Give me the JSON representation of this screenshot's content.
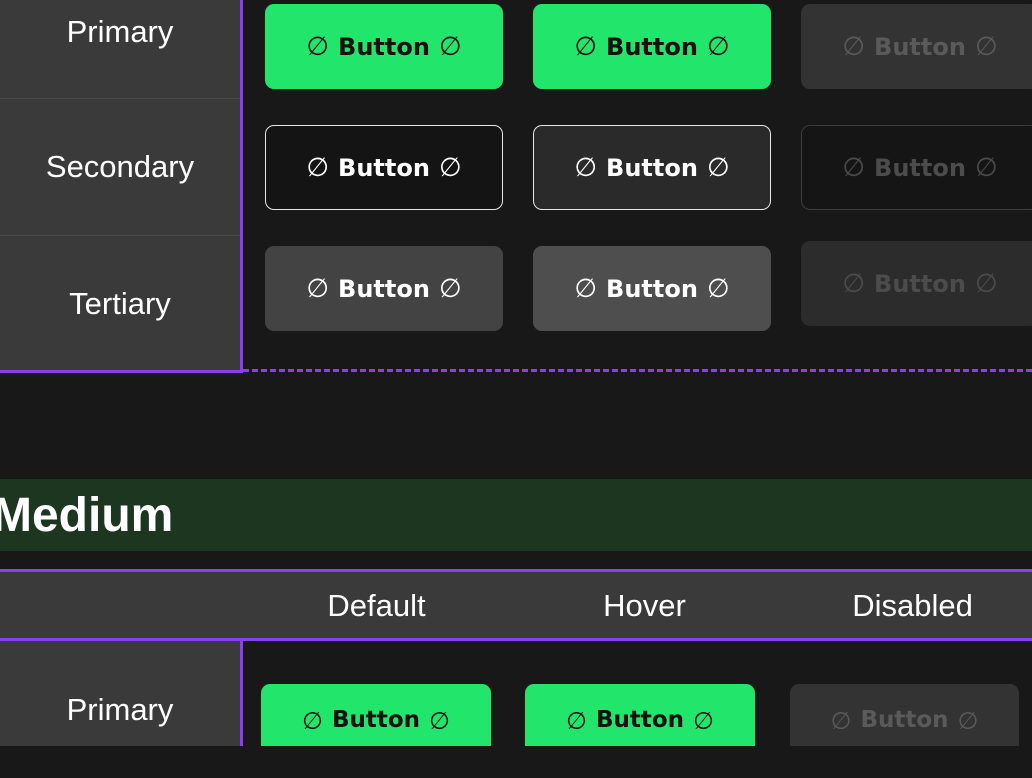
{
  "top_section": {
    "rows": [
      {
        "label": "Primary"
      },
      {
        "label": "Secondary"
      },
      {
        "label": "Tertiary"
      }
    ],
    "button_label": "Button",
    "leading_icon": "∅",
    "trailing_icon": "∅"
  },
  "medium_section": {
    "title": "Medium",
    "columns": [
      "Default",
      "Hover",
      "Disabled"
    ],
    "rows": [
      {
        "label": "Primary"
      }
    ],
    "button_label": "Button",
    "leading_icon": "∅",
    "trailing_icon": "∅"
  },
  "colors": {
    "primary_green": "#22e66b",
    "accent_purple": "#8a3ff0",
    "background": "#181818",
    "label_column": "#3a3a3a",
    "section_band": "#1c3620"
  },
  "icons": {
    "button_icon": "empty-set-icon"
  }
}
